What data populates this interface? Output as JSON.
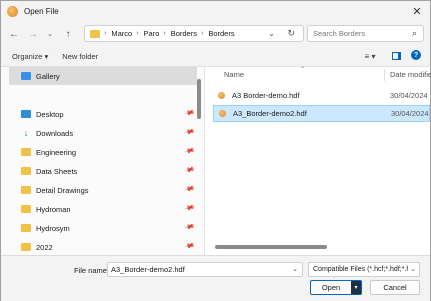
{
  "window": {
    "title": "Open File",
    "close_glyph": "✕"
  },
  "nav": {
    "breadcrumbs": [
      "Marco",
      "Paro",
      "Borders",
      "Borders"
    ],
    "search_placeholder": "Search Borders"
  },
  "toolbar": {
    "organize_label": "Organize ▾",
    "new_folder_label": "New folder",
    "view_glyph": "≡ ▾",
    "help_glyph": "?"
  },
  "sidebar": {
    "items": [
      {
        "label": "Gallery",
        "icon": "gallery-icon",
        "selected": true,
        "pinned": false
      },
      {
        "label": "Desktop",
        "icon": "desktop-icon",
        "pinned": true
      },
      {
        "label": "Downloads",
        "icon": "download-icon",
        "pinned": true
      },
      {
        "label": "Engineering",
        "icon": "folder-icon",
        "pinned": true
      },
      {
        "label": "Data Sheets",
        "icon": "folder-icon",
        "pinned": true
      },
      {
        "label": "Detail Drawings",
        "icon": "folder-icon",
        "pinned": true
      },
      {
        "label": "Hydroman",
        "icon": "folder-icon",
        "pinned": true
      },
      {
        "label": "Hydrosym",
        "icon": "folder-icon",
        "pinned": true
      },
      {
        "label": "2022",
        "icon": "folder-icon",
        "pinned": true
      }
    ]
  },
  "files": {
    "headers": {
      "name": "Name",
      "date": "Date modifie"
    },
    "rows": [
      {
        "name": "A3 Border-demo.hdf",
        "date": "30/04/2024",
        "selected": false
      },
      {
        "name": "A3_Border-demo2.hdf",
        "date": "30/04/2024",
        "selected": true
      }
    ]
  },
  "bottom": {
    "filename_label": "File name:",
    "filename_value": "A3_Border-demo2.hdf",
    "filetype_value": "Compatible Files (*.hcf;*.hdf;*.hv",
    "open_label": "Open",
    "cancel_label": "Cancel"
  },
  "colors": {
    "selection_bg": "#cce8ff",
    "accent": "#0067c0",
    "folder": "#f0c24a"
  }
}
